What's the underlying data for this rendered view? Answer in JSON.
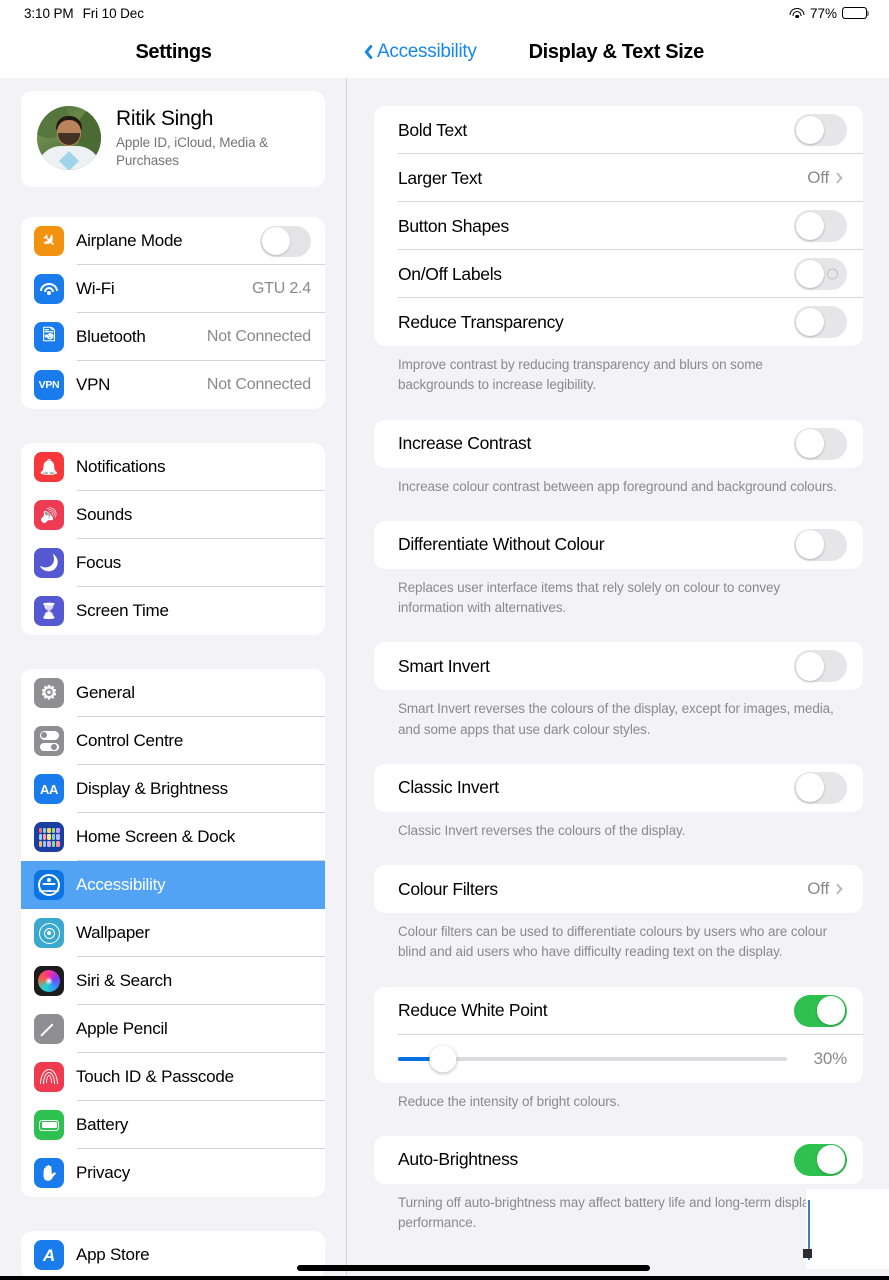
{
  "status_bar": {
    "time": "3:10 PM",
    "date": "Fri 10 Dec",
    "wifi_icon": "wifi-icon",
    "battery_percent": "77%",
    "battery_icon": "battery-icon"
  },
  "sidebar": {
    "title": "Settings",
    "account": {
      "name": "Ritik Singh",
      "subtitle": "Apple ID, iCloud, Media & Purchases",
      "avatar": "user-avatar"
    },
    "groups": [
      {
        "items": [
          {
            "label": "Airplane Mode",
            "icon": "airplane-icon",
            "value": "",
            "control": "toggle",
            "toggle_on": false
          },
          {
            "label": "Wi-Fi",
            "icon": "wifi-icon",
            "value": "GTU 2.4",
            "control": "value"
          },
          {
            "label": "Bluetooth",
            "icon": "bluetooth-icon",
            "value": "Not Connected",
            "control": "value"
          },
          {
            "label": "VPN",
            "icon": "vpn-icon",
            "value": "Not Connected",
            "control": "value"
          }
        ]
      },
      {
        "items": [
          {
            "label": "Notifications",
            "icon": "bell-icon",
            "value": "",
            "control": "none"
          },
          {
            "label": "Sounds",
            "icon": "speaker-icon",
            "value": "",
            "control": "none"
          },
          {
            "label": "Focus",
            "icon": "moon-icon",
            "value": "",
            "control": "none"
          },
          {
            "label": "Screen Time",
            "icon": "hourglass-icon",
            "value": "",
            "control": "none"
          }
        ]
      },
      {
        "items": [
          {
            "label": "General",
            "icon": "gear-icon",
            "value": "",
            "control": "none"
          },
          {
            "label": "Control Centre",
            "icon": "control-centre-icon",
            "value": "",
            "control": "none"
          },
          {
            "label": "Display & Brightness",
            "icon": "aa-icon",
            "value": "",
            "control": "none"
          },
          {
            "label": "Home Screen & Dock",
            "icon": "home-screen-icon",
            "value": "",
            "control": "none"
          },
          {
            "label": "Accessibility",
            "icon": "accessibility-icon",
            "value": "",
            "control": "none",
            "selected": true
          },
          {
            "label": "Wallpaper",
            "icon": "wallpaper-icon",
            "value": "",
            "control": "none"
          },
          {
            "label": "Siri & Search",
            "icon": "siri-icon",
            "value": "",
            "control": "none"
          },
          {
            "label": "Apple Pencil",
            "icon": "pencil-icon",
            "value": "",
            "control": "none"
          },
          {
            "label": "Touch ID & Passcode",
            "icon": "fingerprint-icon",
            "value": "",
            "control": "none"
          },
          {
            "label": "Battery",
            "icon": "battery-icon",
            "value": "",
            "control": "none"
          },
          {
            "label": "Privacy",
            "icon": "hand-icon",
            "value": "",
            "control": "none"
          }
        ]
      },
      {
        "items": [
          {
            "label": "App Store",
            "icon": "app-store-icon",
            "value": "",
            "control": "none"
          }
        ]
      }
    ]
  },
  "detail": {
    "back_label": "Accessibility",
    "back_icon": "chevron-left-icon",
    "title": "Display & Text Size",
    "sections": [
      {
        "rows": [
          {
            "label": "Bold Text",
            "control": "toggle",
            "toggle_on": false
          },
          {
            "label": "Larger Text",
            "control": "disclosure",
            "value": "Off"
          },
          {
            "label": "Button Shapes",
            "control": "toggle",
            "toggle_on": false
          },
          {
            "label": "On/Off Labels",
            "control": "toggle",
            "toggle_on": false,
            "off_mark": true
          },
          {
            "label": "Reduce Transparency",
            "control": "toggle",
            "toggle_on": false
          }
        ],
        "footnote": "Improve contrast by reducing transparency and blurs on some backgrounds to increase legibility."
      },
      {
        "rows": [
          {
            "label": "Increase Contrast",
            "control": "toggle",
            "toggle_on": false
          }
        ],
        "footnote": "Increase colour contrast between app foreground and background colours."
      },
      {
        "rows": [
          {
            "label": "Differentiate Without Colour",
            "control": "toggle",
            "toggle_on": false
          }
        ],
        "footnote": "Replaces user interface items that rely solely on colour to convey information with alternatives."
      },
      {
        "rows": [
          {
            "label": "Smart Invert",
            "control": "toggle",
            "toggle_on": false
          }
        ],
        "footnote": "Smart Invert reverses the colours of the display, except for images, media, and some apps that use dark colour styles."
      },
      {
        "rows": [
          {
            "label": "Classic Invert",
            "control": "toggle",
            "toggle_on": false
          }
        ],
        "footnote": "Classic Invert reverses the colours of the display."
      },
      {
        "rows": [
          {
            "label": "Colour Filters",
            "control": "disclosure",
            "value": "Off"
          }
        ],
        "footnote": "Colour filters can be used to differentiate colours by users who are colour blind and aid users who have difficulty reading text on the display."
      },
      {
        "rows": [
          {
            "label": "Reduce White Point",
            "control": "toggle",
            "toggle_on": true
          },
          {
            "label": "",
            "control": "slider",
            "slider_value": "30%",
            "slider_percent": 11.5
          }
        ],
        "footnote": "Reduce the intensity of bright colours."
      },
      {
        "rows": [
          {
            "label": "Auto-Brightness",
            "control": "toggle",
            "toggle_on": true
          }
        ],
        "footnote": "Turning off auto-brightness may affect battery life and long-term display performance."
      }
    ]
  },
  "colors": {
    "accent_blue": "#1887e8",
    "selection_blue": "#53a3f5",
    "toggle_green": "#2ec14f",
    "slider_blue": "#0a6fe0",
    "background": "#f2f2f7",
    "secondary_text": "#8a8a8e"
  }
}
